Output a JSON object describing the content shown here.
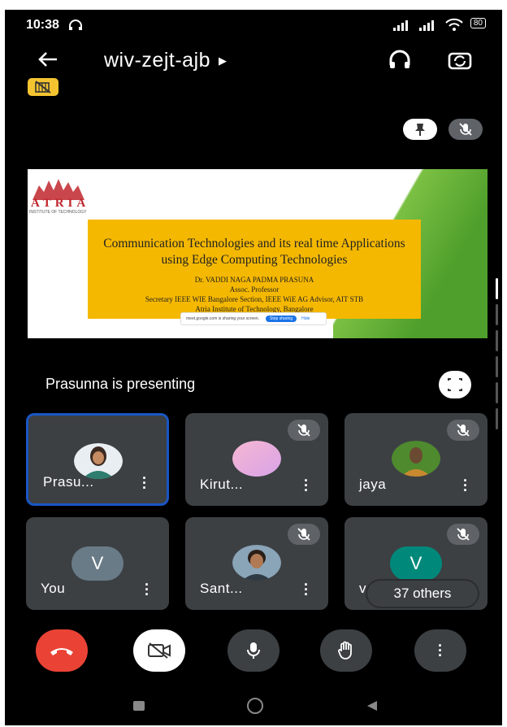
{
  "status": {
    "time": "10:38",
    "battery": "80"
  },
  "header": {
    "meeting_code": "wiv-zejt-ajb"
  },
  "stage": {
    "slide": {
      "logo_text": "ATRIA",
      "logo_sub": "INSTITUTE OF TECHNOLOGY",
      "title": "Communication Technologies and its real time Applications using Edge Computing Technologies",
      "presenter_name": "Dr. VADDI NAGA PADMA PRASUNA",
      "designation": "Assoc. Professor",
      "role": "Secretary IEEE WIE Bangalore Section, IEEE WiE AG Advisor, AIT STB",
      "institute": "Atria Institute of Technology, Bangalore",
      "share_msg": "meet.google.com is sharing your screen.",
      "stop_sharing": "Stop sharing",
      "hide": "Hide"
    },
    "presenting_text": "Prasunna is presenting"
  },
  "tiles": [
    {
      "name": "Prasu...",
      "avatar": "photo-woman"
    },
    {
      "name": "Kirut...",
      "avatar": "pink-blob"
    },
    {
      "name": "jaya",
      "avatar": "photo-man-green"
    },
    {
      "name": "You",
      "letter": "V"
    },
    {
      "name": "Sant...",
      "avatar": "photo-man"
    },
    {
      "name": "v...",
      "letter": "V"
    }
  ],
  "others_label": "37 others",
  "colors": {
    "end_call": "#ea4335",
    "active_border": "#1a56c4",
    "tile_bg": "#3c4043",
    "badge": "#f4c430",
    "teal_avatar": "#00897b",
    "grey_avatar": "#6a7b88"
  }
}
